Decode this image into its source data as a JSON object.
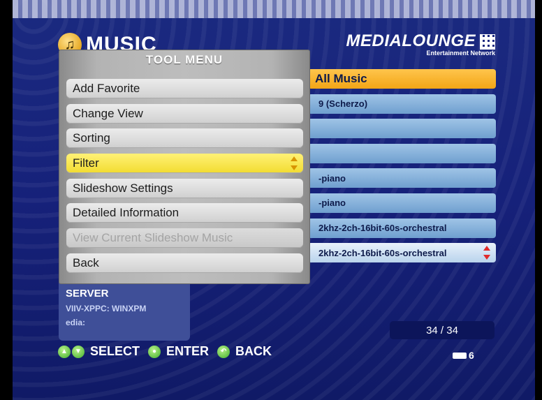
{
  "header": {
    "title": "MUSIC",
    "brand_name": "MEDIALOUNGE",
    "brand_sub": "Entertainment Network"
  },
  "list": {
    "items": [
      {
        "label": "All Music",
        "selected": true
      },
      {
        "label": "9 (Scherzo)"
      },
      {
        "label": ""
      },
      {
        "label": ""
      },
      {
        "label": "-piano"
      },
      {
        "label": "-piano"
      },
      {
        "label": "2khz-2ch-16bit-60s-orchestral"
      },
      {
        "label": "2khz-2ch-16bit-60s-orchestral"
      }
    ]
  },
  "tool_menu": {
    "title": "TOOL MENU",
    "items": [
      {
        "label": "Add Favorite"
      },
      {
        "label": "Change View"
      },
      {
        "label": "Sorting"
      },
      {
        "label": "Filter",
        "selected": true
      },
      {
        "label": "Slideshow Settings"
      },
      {
        "label": "Detailed Information"
      },
      {
        "label": "View Current Slideshow Music",
        "disabled": true
      },
      {
        "label": "Back"
      }
    ]
  },
  "server": {
    "title": "SERVER",
    "name": "VIIV-XPPC: WINXPM",
    "media_label": "edia:"
  },
  "status": {
    "count": "34 / 34",
    "battery_level": "6"
  },
  "footer": {
    "select_label": "SELECT",
    "enter_label": "ENTER",
    "back_label": "BACK"
  },
  "colors": {
    "background": "#16217a",
    "list_highlight": "#f2a516",
    "menu_highlight": "#f2dc30",
    "list_row": "#8ab3dc"
  }
}
